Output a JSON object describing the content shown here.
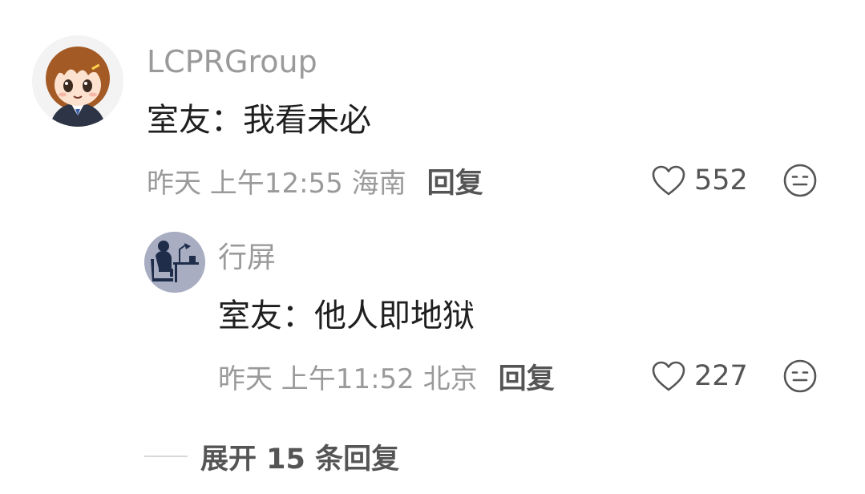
{
  "comment": {
    "username": "LCPRGroup",
    "text": "室友：我看未必",
    "time": "昨天 上午12:55 海南",
    "reply_label": "回复",
    "likes": "552",
    "avatar_icon": "anime-girl-avatar"
  },
  "reply": {
    "username": "行屏",
    "text": "室友：他人即地狱",
    "time": "昨天 上午11:52 北京",
    "reply_label": "回复",
    "likes": "227",
    "avatar_icon": "person-at-desk-avatar"
  },
  "expand": {
    "label": "展开 15 条回复"
  },
  "colors": {
    "meta_gray": "#9a9a9a",
    "action_gray": "#555555",
    "text": "#1f1f1f"
  }
}
